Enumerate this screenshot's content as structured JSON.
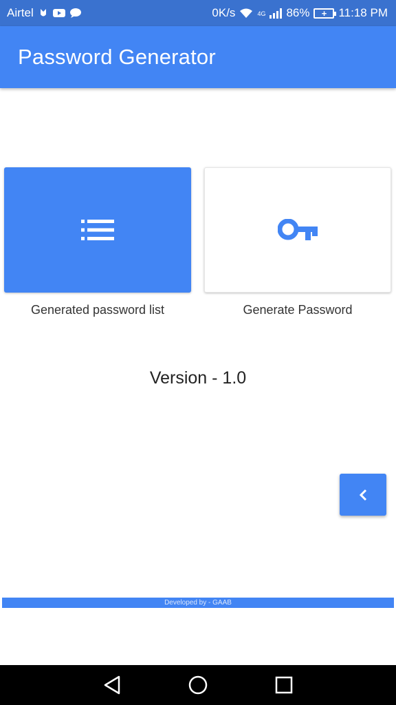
{
  "status_bar": {
    "carrier": "Airtel",
    "speed": "0K/s",
    "network": "4G",
    "battery": "86%",
    "time": "11:18 PM"
  },
  "app_bar": {
    "title": "Password Generator"
  },
  "tiles": [
    {
      "label": "Generated password list",
      "icon": "list-icon"
    },
    {
      "label": "Generate Password",
      "icon": "key-icon"
    }
  ],
  "version": "Version - 1.0",
  "footer": "Developed by - GAAB",
  "colors": {
    "primary": "#4285f4",
    "status_bar": "#3a72cf",
    "nav_bar": "#000000"
  }
}
